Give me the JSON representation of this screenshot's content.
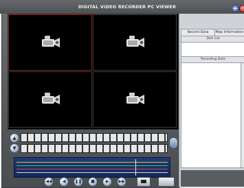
{
  "window": {
    "title": "DIGITAL VIDEO RECORDER PC VIEWER"
  },
  "video": {
    "channels": [
      {
        "id": 1,
        "state": "no-signal",
        "icon": "camera-icon",
        "active": true
      },
      {
        "id": 2,
        "state": "no-signal",
        "icon": "camera-icon",
        "active": false
      },
      {
        "id": 3,
        "state": "no-signal",
        "icon": "camera-icon",
        "active": false
      },
      {
        "id": 4,
        "state": "no-signal",
        "icon": "camera-icon",
        "active": false
      }
    ]
  },
  "timeline": {
    "rows": 2,
    "track_colors": [
      "#d9d9d9",
      "#3dbb56",
      "#d34b4b",
      "#e0c23a"
    ]
  },
  "controls": {
    "icons": [
      "rewind-icon",
      "play-icon",
      "pause-icon",
      "stop-icon",
      "forward-icon",
      "step-icon",
      "snapshot-icon",
      "settings-icon"
    ]
  },
  "right_panel": {
    "tabs": [
      "Record Data",
      "Map Information"
    ],
    "disk_list_title": "Disk List",
    "recording_date_title": "Recording Date"
  },
  "colors": {
    "active_channel_border": "#9a1f1f",
    "track_background": "#1a3068",
    "panel_background": "#cfd3d7"
  }
}
